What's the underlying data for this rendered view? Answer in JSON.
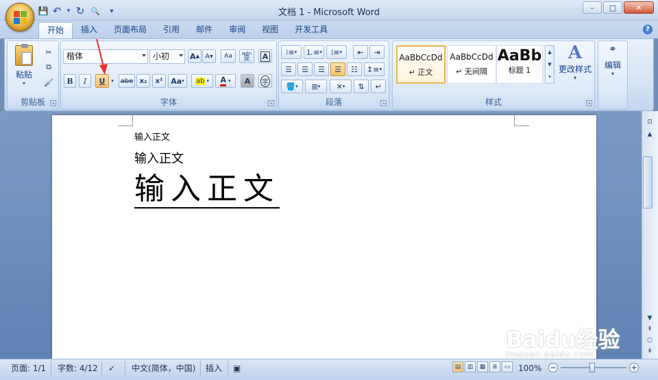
{
  "window": {
    "title": "文档 1 - Microsoft Word",
    "controls": {
      "minimize": "–",
      "maximize": "□",
      "close": "✕"
    }
  },
  "qat": {
    "save_icon": "💾",
    "undo_icon": "↶",
    "redo_icon": "↻",
    "preview_icon": "🔍",
    "dropdown_icon": "▾"
  },
  "tabs": [
    {
      "label": "开始",
      "active": true
    },
    {
      "label": "插入"
    },
    {
      "label": "页面布局"
    },
    {
      "label": "引用"
    },
    {
      "label": "邮件"
    },
    {
      "label": "审阅"
    },
    {
      "label": "视图"
    },
    {
      "label": "开发工具"
    }
  ],
  "help": "?",
  "clipboard": {
    "paste_label": "粘贴",
    "group_label": "剪贴板"
  },
  "font": {
    "font_name": "楷体",
    "font_size": "小初",
    "grow": "A",
    "shrink": "A",
    "clear_format": "Aa",
    "wen": "wén",
    "wen_char": "变",
    "char_border": "A",
    "bold": "B",
    "italic": "I",
    "underline": "U",
    "strike": "abe",
    "sub": "x₂",
    "sup": "x²",
    "case": "Aa",
    "highlight": "ab",
    "color": "A",
    "shade": "A",
    "enclose": "字",
    "group_label": "字体"
  },
  "paragraph": {
    "group_label": "段落"
  },
  "styles": {
    "items": [
      {
        "sample": "AaBbCcDd",
        "name": "↵ 正文",
        "selected": true
      },
      {
        "sample": "AaBbCcDd",
        "name": "↵ 无间隔"
      },
      {
        "sample": "AaBb",
        "name": "标题 1"
      }
    ],
    "change_label": "更改样式",
    "group_label": "样式"
  },
  "editing": {
    "label": "编辑"
  },
  "document": {
    "line1": "输入正文",
    "line2": "输入正文",
    "line3": "输入正文"
  },
  "status": {
    "page": "页面: 1/1",
    "words": "字数: 4/12",
    "language": "中文(简体，中国)",
    "insert": "插入",
    "zoom": "100%",
    "zoom_minus": "−",
    "zoom_plus": "+"
  },
  "watermark": {
    "brand": "Baidu经验",
    "url": "jingyan.baidu.com"
  },
  "colors": {
    "accent_orange": "#f9c270",
    "annotation_red": "#e8322c",
    "ribbon_blue": "#15428b"
  }
}
